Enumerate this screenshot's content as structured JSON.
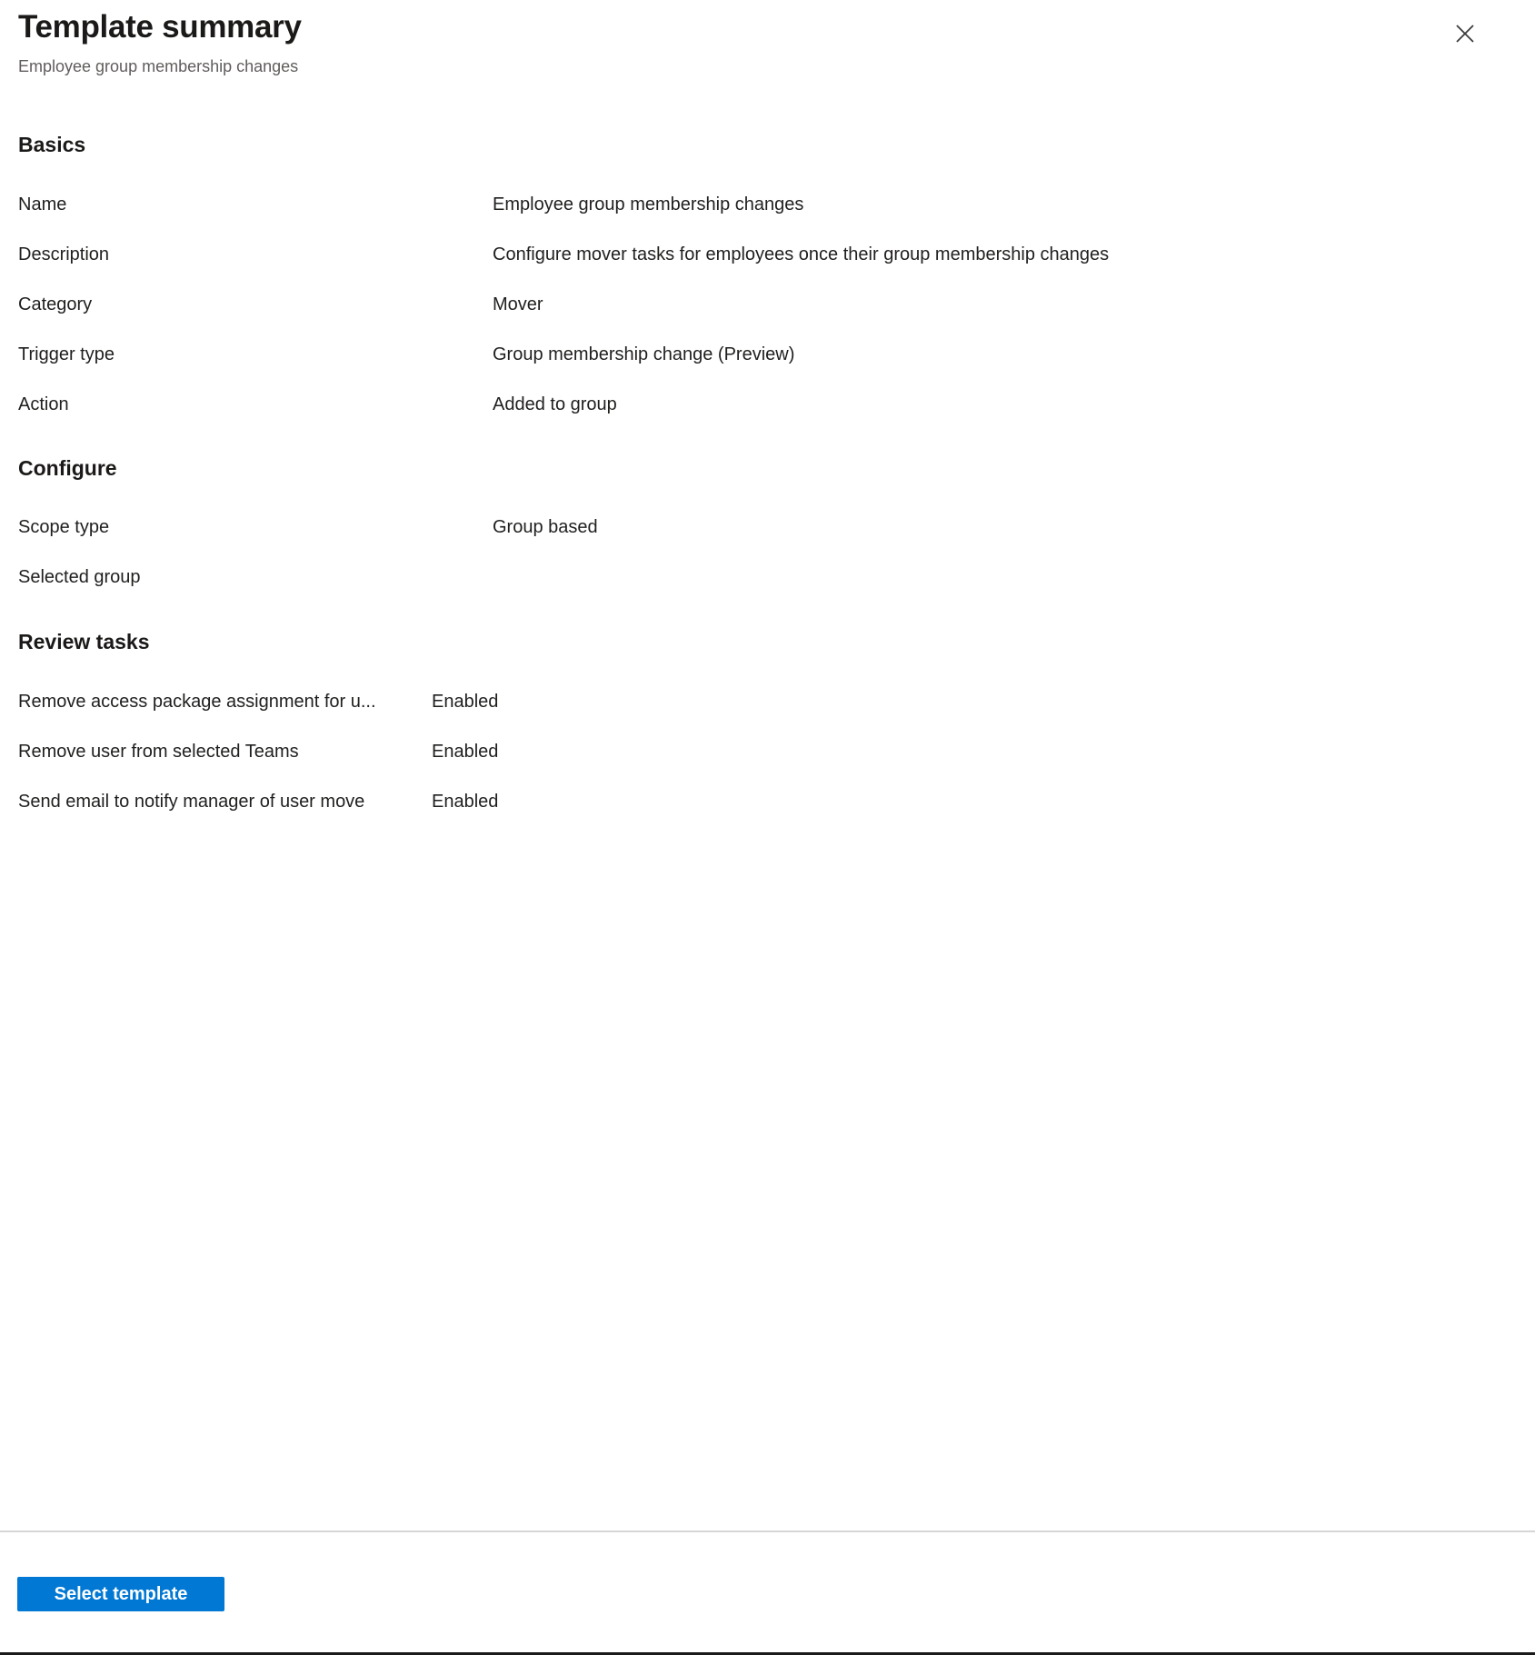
{
  "header": {
    "title": "Template summary",
    "subtitle": "Employee group membership changes",
    "close_icon": "close-icon"
  },
  "sections": [
    {
      "id": "basics",
      "heading": "Basics",
      "rows": [
        {
          "label": "Name",
          "value": "Employee group membership changes"
        },
        {
          "label": "Description",
          "value": "Configure mover tasks for employees once their group membership changes"
        },
        {
          "label": "Category",
          "value": "Mover"
        },
        {
          "label": "Trigger type",
          "value": "Group membership change (Preview)"
        },
        {
          "label": "Action",
          "value": "Added to group"
        }
      ]
    },
    {
      "id": "configure",
      "heading": "Configure",
      "rows": [
        {
          "label": "Scope type",
          "value": "Group based"
        },
        {
          "label": "Selected group",
          "value": ""
        }
      ]
    },
    {
      "id": "review",
      "heading": "Review tasks",
      "rows": [
        {
          "label": "Remove access package assignment for u...",
          "value": "Enabled"
        },
        {
          "label": "Remove user from selected Teams",
          "value": "Enabled"
        },
        {
          "label": "Send email to notify manager of user move",
          "value": "Enabled"
        }
      ]
    }
  ],
  "footer": {
    "primary_button": "Select template"
  },
  "colors": {
    "accent": "#0078d4",
    "text_primary": "#201f1e",
    "text_secondary": "#605e5c",
    "divider": "#d6d6d6",
    "background": "#ffffff"
  }
}
